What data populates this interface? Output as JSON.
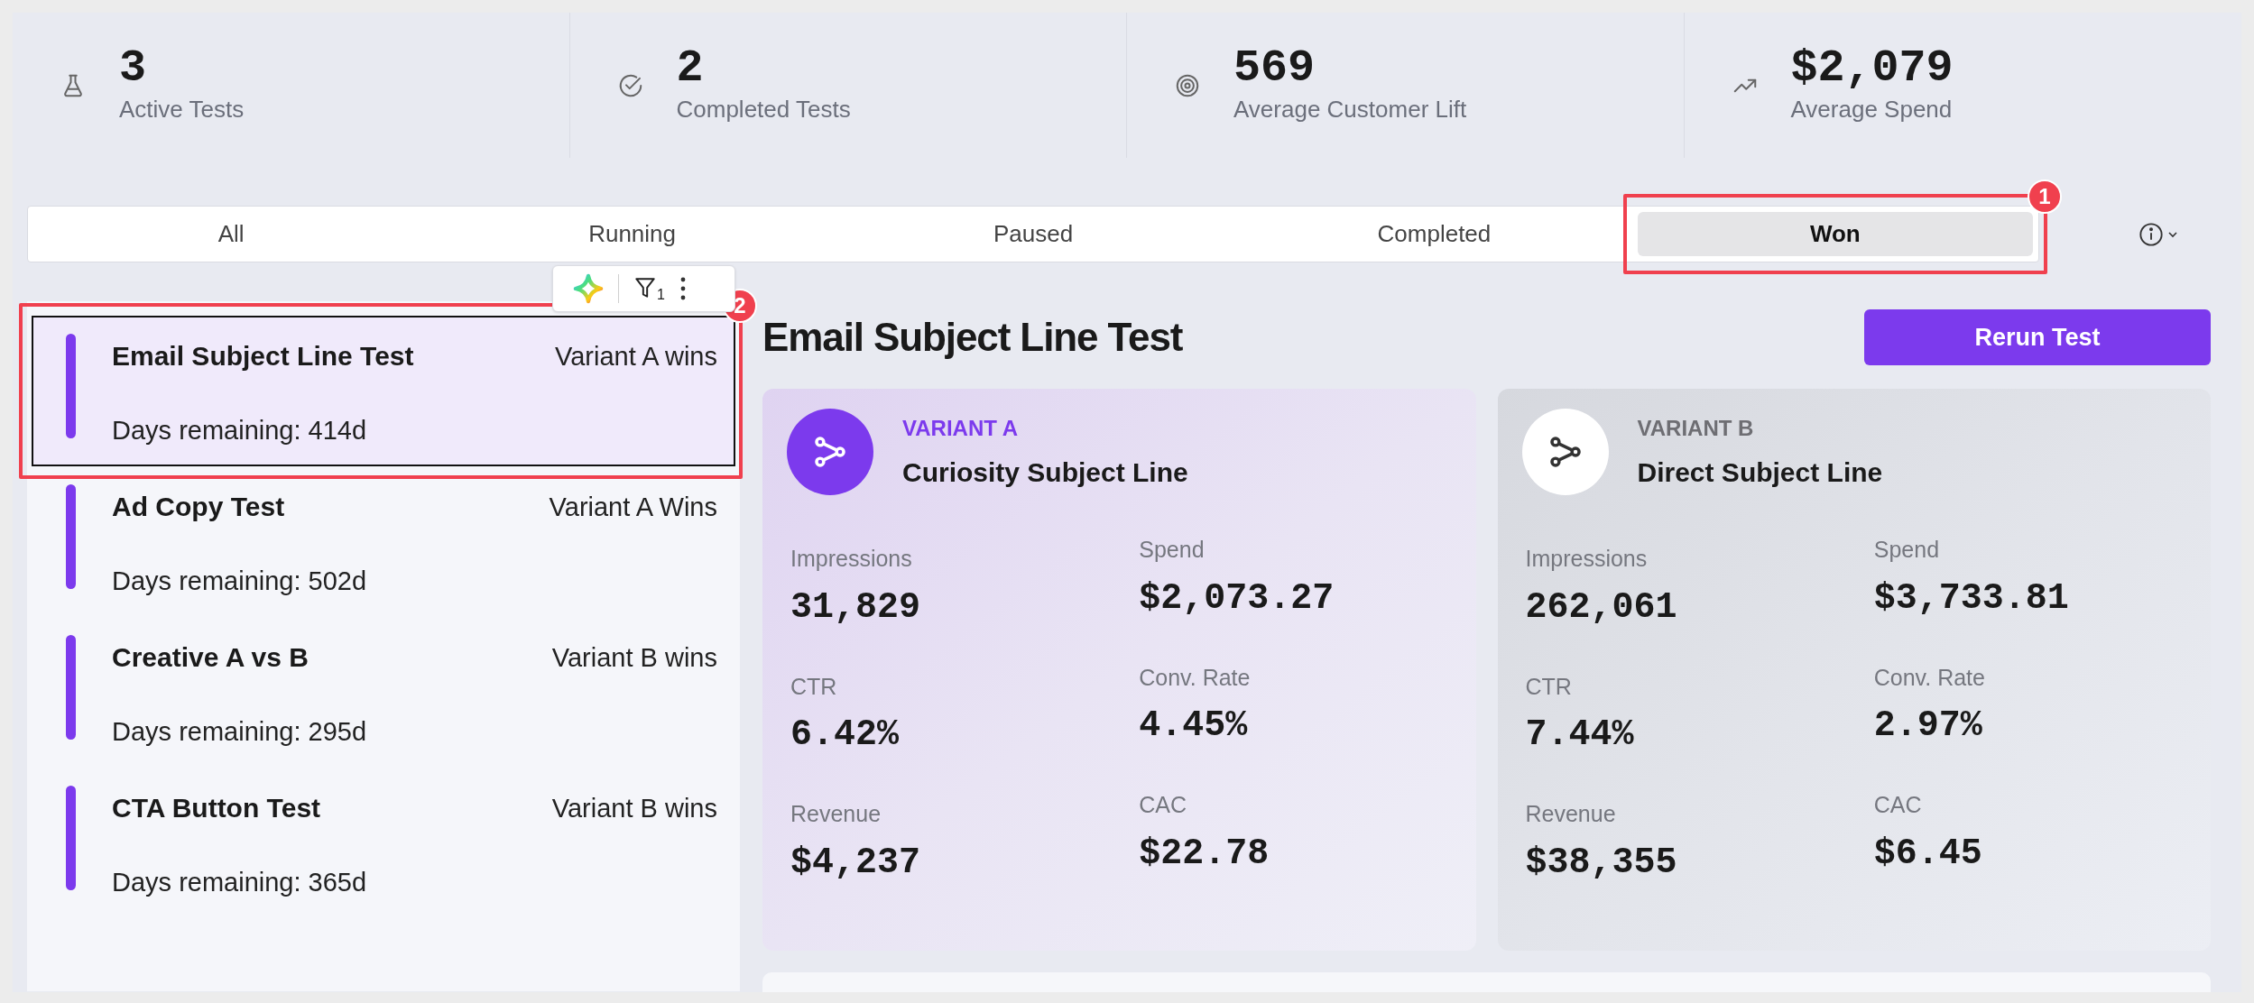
{
  "stats": [
    {
      "value": "3",
      "label": "Active Tests"
    },
    {
      "value": "2",
      "label": "Completed Tests"
    },
    {
      "value": "569",
      "label": "Average Customer Lift"
    },
    {
      "value": "$2,079",
      "label": "Average Spend"
    }
  ],
  "tabs": [
    {
      "label": "All",
      "selected": false
    },
    {
      "label": "Running",
      "selected": false
    },
    {
      "label": "Paused",
      "selected": false
    },
    {
      "label": "Completed",
      "selected": false
    },
    {
      "label": "Won",
      "selected": true,
      "annotation": "1"
    }
  ],
  "toolbar": {
    "filter_count": "1"
  },
  "tests": [
    {
      "name": "Email Subject Line Test",
      "result": "Variant A wins",
      "days": "Days remaining: 414d",
      "selected": true,
      "annotation": "2"
    },
    {
      "name": "Ad Copy Test",
      "result": "Variant A Wins",
      "days": "Days remaining: 502d",
      "selected": false
    },
    {
      "name": "Creative A vs B",
      "result": "Variant B wins",
      "days": "Days remaining: 295d",
      "selected": false
    },
    {
      "name": "CTA Button Test",
      "result": "Variant B wins",
      "days": "Days remaining: 365d",
      "selected": false
    }
  ],
  "detail": {
    "title": "Email Subject Line Test",
    "button": "Rerun Test",
    "variants": [
      {
        "label": "VARIANT A",
        "name": "Curiosity Subject Line",
        "highlighted": true,
        "metrics": [
          {
            "label": "Impressions",
            "value": "31,829"
          },
          {
            "label": "Spend",
            "value": "$2,073.27"
          },
          {
            "label": "CTR",
            "value": "6.42%"
          },
          {
            "label": "Conv. Rate",
            "value": "4.45%"
          },
          {
            "label": "Revenue",
            "value": "$4,237"
          },
          {
            "label": "CAC",
            "value": "$22.78"
          }
        ]
      },
      {
        "label": "VARIANT B",
        "name": "Direct Subject Line",
        "highlighted": false,
        "metrics": [
          {
            "label": "Impressions",
            "value": "262,061"
          },
          {
            "label": "Spend",
            "value": "$3,733.81"
          },
          {
            "label": "CTR",
            "value": "7.44%"
          },
          {
            "label": "Conv. Rate",
            "value": "2.97%"
          },
          {
            "label": "Revenue",
            "value": "$38,355"
          },
          {
            "label": "CAC",
            "value": "$6.45"
          }
        ]
      }
    ]
  }
}
